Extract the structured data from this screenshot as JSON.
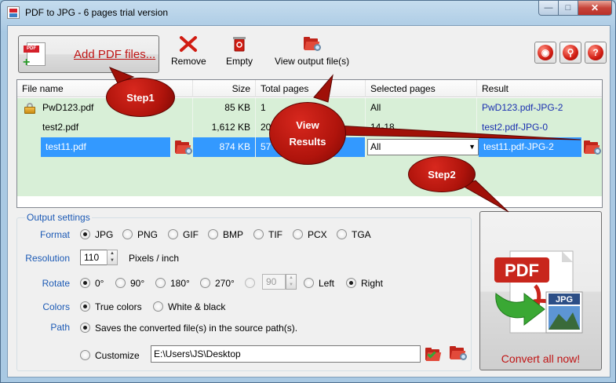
{
  "window": {
    "title": "PDF to JPG - 6 pages trial version"
  },
  "toolbar": {
    "add_pdf_label": "Add PDF files...",
    "remove_label": "Remove",
    "empty_label": "Empty",
    "view_output_label": "View output file(s)",
    "icons": [
      "remove-icon",
      "empty-trash-icon",
      "view-output-folder-icon",
      "web-icon",
      "settings-icon",
      "help-icon"
    ]
  },
  "grid": {
    "headers": [
      "File name",
      "Size",
      "Total pages",
      "Selected pages",
      "Result"
    ],
    "rows": [
      {
        "name": "PwD123.pdf",
        "size": "85 KB",
        "pages": "1",
        "selected": "All",
        "result": "PwD123.pdf-JPG-2",
        "locked": true
      },
      {
        "name": "test2.pdf",
        "size": "1,612 KB",
        "pages": "20",
        "selected": "14-18",
        "result": "test2.pdf-JPG-0"
      },
      {
        "name": "test11.pdf",
        "size": "874 KB",
        "pages": "57",
        "selected": "All",
        "result": "test11.pdf-JPG-2"
      }
    ]
  },
  "output": {
    "title": "Output settings",
    "format_label": "Format",
    "formats": [
      "JPG",
      "PNG",
      "GIF",
      "BMP",
      "TIF",
      "PCX",
      "TGA"
    ],
    "selected_format": "JPG",
    "resolution_label": "Resolution",
    "resolution_value": "110",
    "resolution_unit": "Pixels / inch",
    "rotate_label": "Rotate",
    "rotate_options": [
      "0°",
      "90°",
      "180°",
      "270°"
    ],
    "rotate_custom_value": "90",
    "left_label": "Left",
    "right_label": "Right",
    "colors_label": "Colors",
    "true_colors_label": "True colors",
    "white_black_label": "White & black",
    "path_label": "Path",
    "source_path_label": "Saves the converted file(s) in the source path(s).",
    "customize_label": "Customize",
    "custom_path": "E:\\Users\\JS\\Desktop"
  },
  "convert": {
    "label": "Convert all now!",
    "icon_text_pdf": "PDF",
    "icon_text_jpg": "JPG"
  },
  "callouts": {
    "step1": "Step1",
    "view_results_line1": "View",
    "view_results_line2": "Results",
    "step2": "Step2"
  },
  "colors": {
    "accent_red": "#c01414",
    "link_blue": "#1a2fb0",
    "label_blue": "#1c5ab5",
    "row_green": "#d8efd7",
    "selection": "#3399ff"
  }
}
